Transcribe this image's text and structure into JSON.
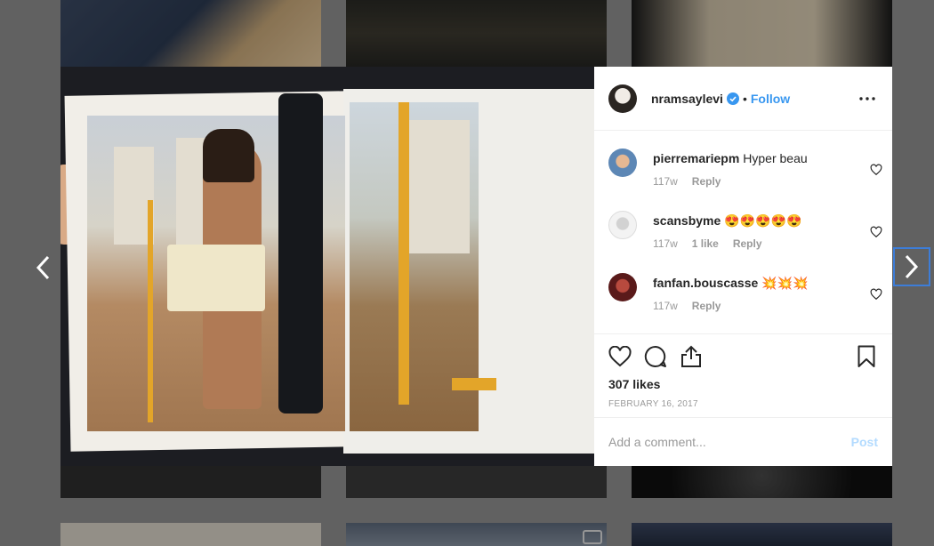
{
  "post": {
    "author": "nramsaylevi",
    "dot": "•",
    "follow_label": "Follow",
    "likes": "307 likes",
    "date": "FEBRUARY 16, 2017"
  },
  "comments": [
    {
      "user": "pierremariepm",
      "text": "Hyper beau",
      "age": "117w",
      "likes": "",
      "reply": "Reply"
    },
    {
      "user": "scansbyme",
      "text": "😍😍😍😍😍",
      "age": "117w",
      "likes": "1 like",
      "reply": "Reply"
    },
    {
      "user": "fanfan.bouscasse",
      "text": "💥💥💥",
      "age": "117w",
      "likes": "",
      "reply": "Reply"
    }
  ],
  "composer": {
    "placeholder": "Add a comment...",
    "post_label": "Post"
  },
  "icons": {
    "prev": "chevron-left-icon",
    "next": "chevron-right-icon",
    "more": "more-options-icon",
    "verified": "verified-badge-icon",
    "like": "heart-icon",
    "comment": "comment-bubble-icon",
    "share": "share-icon",
    "save": "bookmark-icon"
  },
  "colors": {
    "accent": "#3897f0",
    "post_disabled": "#b3dbff",
    "focus_outline": "#3d7dd8"
  }
}
